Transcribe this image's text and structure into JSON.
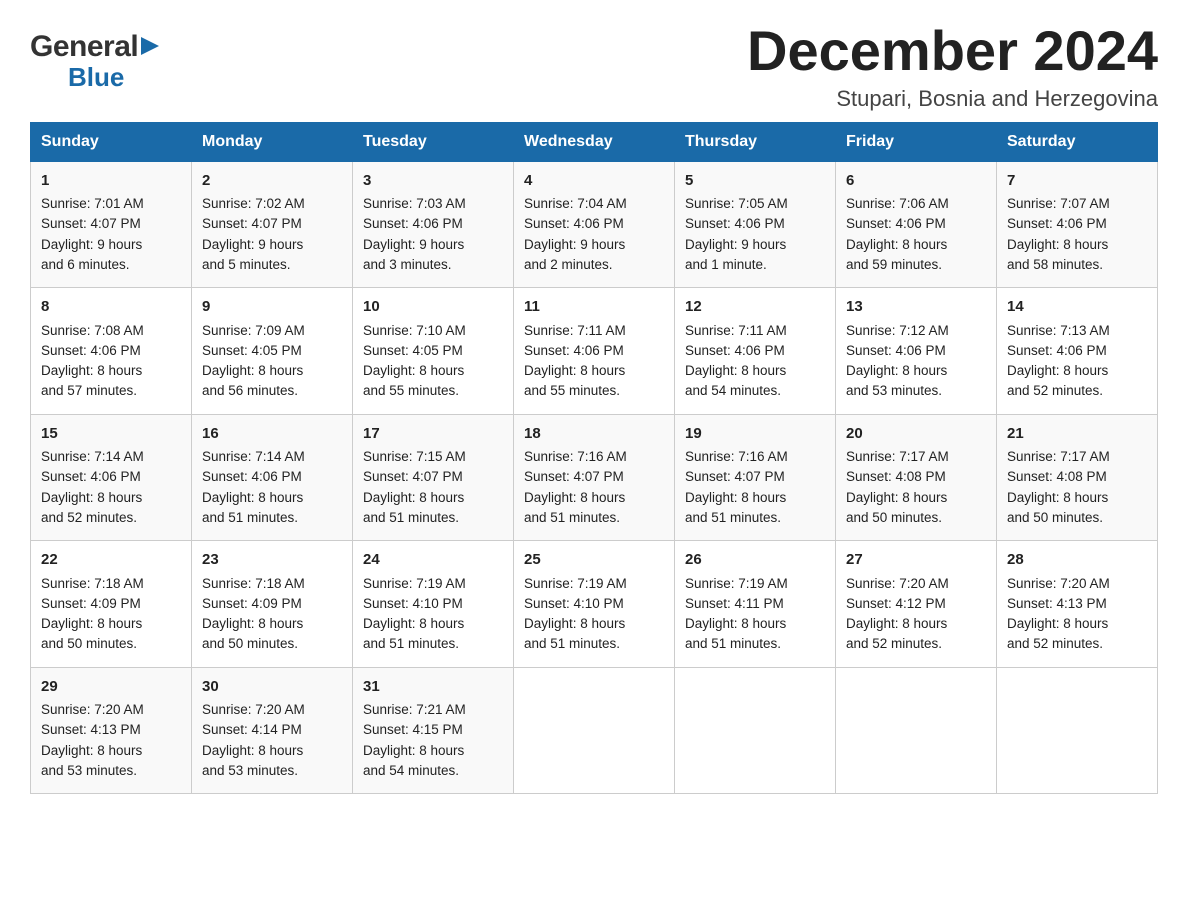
{
  "logo": {
    "general": "General",
    "blue": "Blue",
    "triangle": "▶"
  },
  "title": "December 2024",
  "location": "Stupari, Bosnia and Herzegovina",
  "headers": [
    "Sunday",
    "Monday",
    "Tuesday",
    "Wednesday",
    "Thursday",
    "Friday",
    "Saturday"
  ],
  "weeks": [
    [
      {
        "day": "1",
        "sunrise": "Sunrise: 7:01 AM",
        "sunset": "Sunset: 4:07 PM",
        "daylight": "Daylight: 9 hours",
        "minutes": "and 6 minutes."
      },
      {
        "day": "2",
        "sunrise": "Sunrise: 7:02 AM",
        "sunset": "Sunset: 4:07 PM",
        "daylight": "Daylight: 9 hours",
        "minutes": "and 5 minutes."
      },
      {
        "day": "3",
        "sunrise": "Sunrise: 7:03 AM",
        "sunset": "Sunset: 4:06 PM",
        "daylight": "Daylight: 9 hours",
        "minutes": "and 3 minutes."
      },
      {
        "day": "4",
        "sunrise": "Sunrise: 7:04 AM",
        "sunset": "Sunset: 4:06 PM",
        "daylight": "Daylight: 9 hours",
        "minutes": "and 2 minutes."
      },
      {
        "day": "5",
        "sunrise": "Sunrise: 7:05 AM",
        "sunset": "Sunset: 4:06 PM",
        "daylight": "Daylight: 9 hours",
        "minutes": "and 1 minute."
      },
      {
        "day": "6",
        "sunrise": "Sunrise: 7:06 AM",
        "sunset": "Sunset: 4:06 PM",
        "daylight": "Daylight: 8 hours",
        "minutes": "and 59 minutes."
      },
      {
        "day": "7",
        "sunrise": "Sunrise: 7:07 AM",
        "sunset": "Sunset: 4:06 PM",
        "daylight": "Daylight: 8 hours",
        "minutes": "and 58 minutes."
      }
    ],
    [
      {
        "day": "8",
        "sunrise": "Sunrise: 7:08 AM",
        "sunset": "Sunset: 4:06 PM",
        "daylight": "Daylight: 8 hours",
        "minutes": "and 57 minutes."
      },
      {
        "day": "9",
        "sunrise": "Sunrise: 7:09 AM",
        "sunset": "Sunset: 4:05 PM",
        "daylight": "Daylight: 8 hours",
        "minutes": "and 56 minutes."
      },
      {
        "day": "10",
        "sunrise": "Sunrise: 7:10 AM",
        "sunset": "Sunset: 4:05 PM",
        "daylight": "Daylight: 8 hours",
        "minutes": "and 55 minutes."
      },
      {
        "day": "11",
        "sunrise": "Sunrise: 7:11 AM",
        "sunset": "Sunset: 4:06 PM",
        "daylight": "Daylight: 8 hours",
        "minutes": "and 55 minutes."
      },
      {
        "day": "12",
        "sunrise": "Sunrise: 7:11 AM",
        "sunset": "Sunset: 4:06 PM",
        "daylight": "Daylight: 8 hours",
        "minutes": "and 54 minutes."
      },
      {
        "day": "13",
        "sunrise": "Sunrise: 7:12 AM",
        "sunset": "Sunset: 4:06 PM",
        "daylight": "Daylight: 8 hours",
        "minutes": "and 53 minutes."
      },
      {
        "day": "14",
        "sunrise": "Sunrise: 7:13 AM",
        "sunset": "Sunset: 4:06 PM",
        "daylight": "Daylight: 8 hours",
        "minutes": "and 52 minutes."
      }
    ],
    [
      {
        "day": "15",
        "sunrise": "Sunrise: 7:14 AM",
        "sunset": "Sunset: 4:06 PM",
        "daylight": "Daylight: 8 hours",
        "minutes": "and 52 minutes."
      },
      {
        "day": "16",
        "sunrise": "Sunrise: 7:14 AM",
        "sunset": "Sunset: 4:06 PM",
        "daylight": "Daylight: 8 hours",
        "minutes": "and 51 minutes."
      },
      {
        "day": "17",
        "sunrise": "Sunrise: 7:15 AM",
        "sunset": "Sunset: 4:07 PM",
        "daylight": "Daylight: 8 hours",
        "minutes": "and 51 minutes."
      },
      {
        "day": "18",
        "sunrise": "Sunrise: 7:16 AM",
        "sunset": "Sunset: 4:07 PM",
        "daylight": "Daylight: 8 hours",
        "minutes": "and 51 minutes."
      },
      {
        "day": "19",
        "sunrise": "Sunrise: 7:16 AM",
        "sunset": "Sunset: 4:07 PM",
        "daylight": "Daylight: 8 hours",
        "minutes": "and 51 minutes."
      },
      {
        "day": "20",
        "sunrise": "Sunrise: 7:17 AM",
        "sunset": "Sunset: 4:08 PM",
        "daylight": "Daylight: 8 hours",
        "minutes": "and 50 minutes."
      },
      {
        "day": "21",
        "sunrise": "Sunrise: 7:17 AM",
        "sunset": "Sunset: 4:08 PM",
        "daylight": "Daylight: 8 hours",
        "minutes": "and 50 minutes."
      }
    ],
    [
      {
        "day": "22",
        "sunrise": "Sunrise: 7:18 AM",
        "sunset": "Sunset: 4:09 PM",
        "daylight": "Daylight: 8 hours",
        "minutes": "and 50 minutes."
      },
      {
        "day": "23",
        "sunrise": "Sunrise: 7:18 AM",
        "sunset": "Sunset: 4:09 PM",
        "daylight": "Daylight: 8 hours",
        "minutes": "and 50 minutes."
      },
      {
        "day": "24",
        "sunrise": "Sunrise: 7:19 AM",
        "sunset": "Sunset: 4:10 PM",
        "daylight": "Daylight: 8 hours",
        "minutes": "and 51 minutes."
      },
      {
        "day": "25",
        "sunrise": "Sunrise: 7:19 AM",
        "sunset": "Sunset: 4:10 PM",
        "daylight": "Daylight: 8 hours",
        "minutes": "and 51 minutes."
      },
      {
        "day": "26",
        "sunrise": "Sunrise: 7:19 AM",
        "sunset": "Sunset: 4:11 PM",
        "daylight": "Daylight: 8 hours",
        "minutes": "and 51 minutes."
      },
      {
        "day": "27",
        "sunrise": "Sunrise: 7:20 AM",
        "sunset": "Sunset: 4:12 PM",
        "daylight": "Daylight: 8 hours",
        "minutes": "and 52 minutes."
      },
      {
        "day": "28",
        "sunrise": "Sunrise: 7:20 AM",
        "sunset": "Sunset: 4:13 PM",
        "daylight": "Daylight: 8 hours",
        "minutes": "and 52 minutes."
      }
    ],
    [
      {
        "day": "29",
        "sunrise": "Sunrise: 7:20 AM",
        "sunset": "Sunset: 4:13 PM",
        "daylight": "Daylight: 8 hours",
        "minutes": "and 53 minutes."
      },
      {
        "day": "30",
        "sunrise": "Sunrise: 7:20 AM",
        "sunset": "Sunset: 4:14 PM",
        "daylight": "Daylight: 8 hours",
        "minutes": "and 53 minutes."
      },
      {
        "day": "31",
        "sunrise": "Sunrise: 7:21 AM",
        "sunset": "Sunset: 4:15 PM",
        "daylight": "Daylight: 8 hours",
        "minutes": "and 54 minutes."
      },
      null,
      null,
      null,
      null
    ]
  ]
}
